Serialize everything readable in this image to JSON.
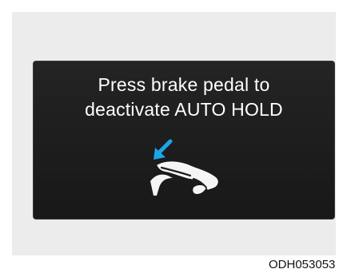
{
  "display": {
    "message_line1": "Press brake pedal to",
    "message_line2": "deactivate AUTO HOLD",
    "icon": "foot-pressing-brake-pedal-icon",
    "background_color": "#1e1e1e",
    "text_color": "#ffffff",
    "arrow_color": "#1aa6e8"
  },
  "figure_code": "ODH053053"
}
